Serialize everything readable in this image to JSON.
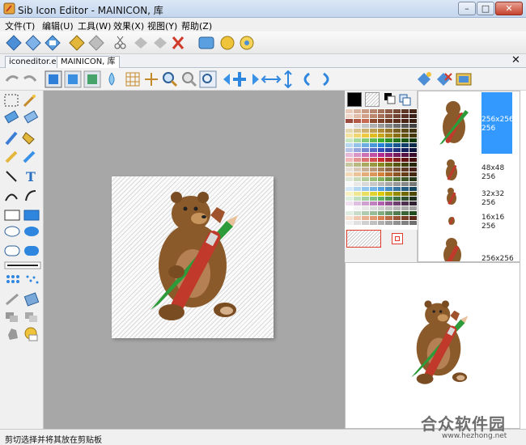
{
  "window": {
    "title": "Sib Icon Editor - MAINICON, 库"
  },
  "menu": [
    "文件(T)",
    "编辑(U)",
    "工具(W)",
    "效果(X)",
    "视图(Y)",
    "帮助(Z)"
  ],
  "tabs": [
    {
      "label": "iconeditor.exe",
      "active": false
    },
    {
      "label": "MAINICON, 库",
      "active": true
    }
  ],
  "formats": [
    {
      "size": "256x256",
      "colors": "256",
      "selected": true
    },
    {
      "size": "48x48",
      "colors": "256",
      "selected": false
    },
    {
      "size": "32x32",
      "colors": "256",
      "selected": false
    },
    {
      "size": "16x16",
      "colors": "256",
      "selected": false
    },
    {
      "size": "256x256",
      "colors": "",
      "selected": false
    }
  ],
  "status": {
    "text": "剪切选择并将其放在剪贴板"
  },
  "watermark": {
    "name": "合众软件园",
    "url": "www.hezhong.net"
  },
  "colors": {
    "selection": "#3399ff",
    "canvas_bg": "#a7a7a7"
  }
}
